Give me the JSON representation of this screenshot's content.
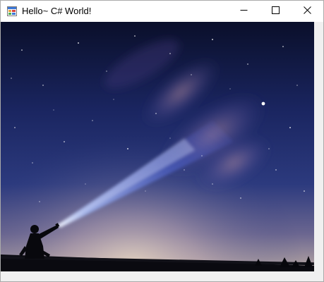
{
  "window": {
    "title": "Hello~ C# World!",
    "app_icon": "windows-form-icon",
    "controls": {
      "minimize_icon": "minimize-icon",
      "maximize_icon": "maximize-icon",
      "close_icon": "close-icon"
    }
  },
  "picture": {
    "subject_icon": "night-sky-flashlight-photo"
  },
  "colors": {
    "titlebar": "#ffffff",
    "client_background": "#f0f0f0",
    "sky_top": "#0b1030",
    "beam": "#6a8cff"
  }
}
